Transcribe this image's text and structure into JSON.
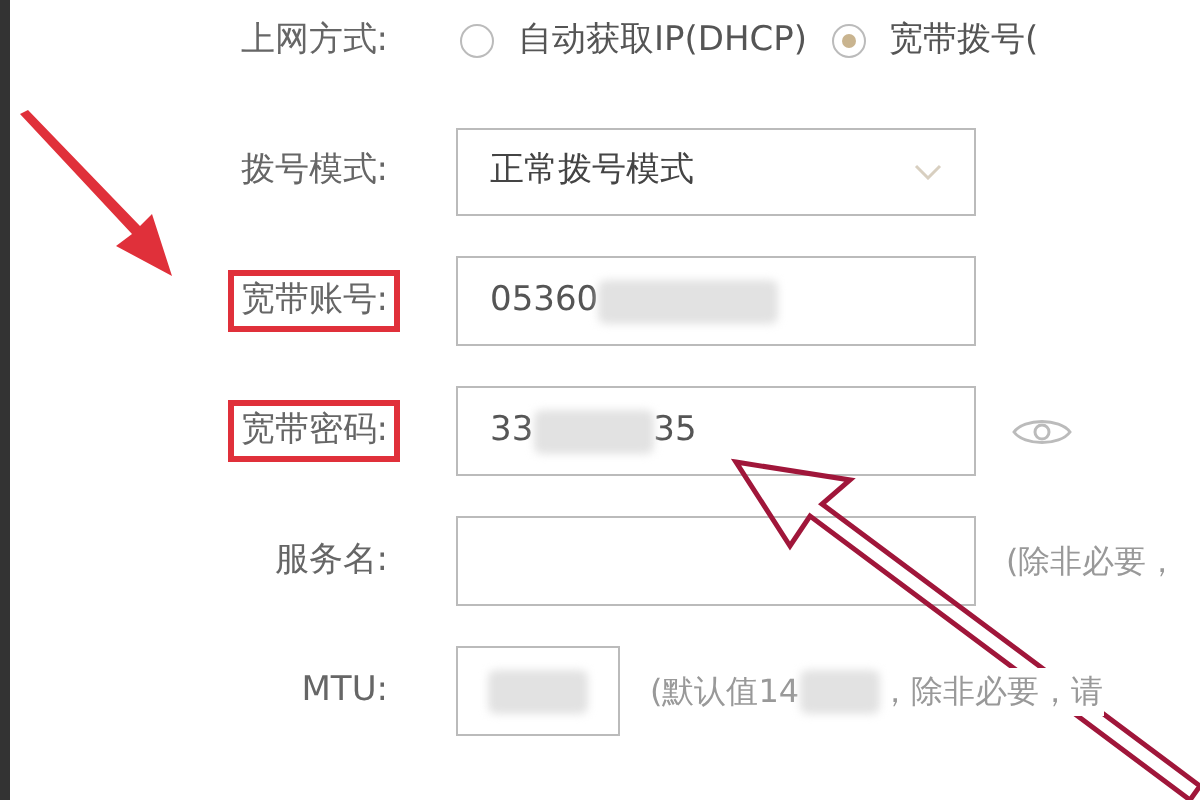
{
  "rows": [
    {
      "kind": "radio",
      "label": "上网方式:",
      "highlighted": false,
      "options": [
        {
          "label": "自动获取IP(DHCP)",
          "selected": false
        },
        {
          "label": "宽带拨号(",
          "selected": true
        }
      ]
    },
    {
      "kind": "select",
      "label": "拨号模式:",
      "highlighted": false,
      "value": "正常拨号模式"
    },
    {
      "kind": "text",
      "label": "宽带账号:",
      "highlighted": true,
      "value": "05360",
      "masked_tail": true
    },
    {
      "kind": "password",
      "label": "宽带密码:",
      "highlighted": true,
      "value": "33",
      "value_after_mask": "35"
    },
    {
      "kind": "text",
      "label": "服务名:",
      "highlighted": false,
      "hint": "(除非必要，"
    },
    {
      "kind": "mtu",
      "label": "MTU:",
      "highlighted": false,
      "hint": "(默认值14",
      "hint_after_mask": "，除非必要，请"
    }
  ]
}
